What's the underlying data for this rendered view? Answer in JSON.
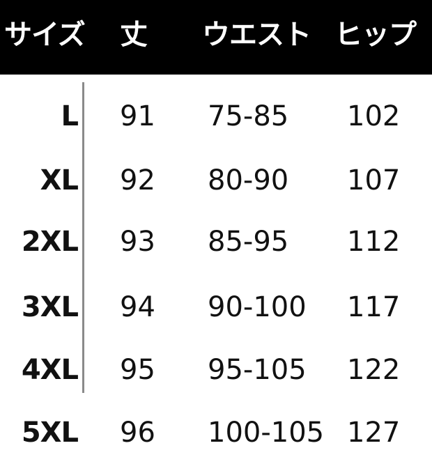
{
  "table": {
    "headers": {
      "size": "サイズ",
      "length": "丈",
      "waist": "ウエスト",
      "hip": "ヒップ"
    },
    "rows": [
      {
        "size": "L",
        "length": "91",
        "waist": "75-85",
        "hip": "102"
      },
      {
        "size": "XL",
        "length": "92",
        "waist": "80-90",
        "hip": "107"
      },
      {
        "size": "2XL",
        "length": "93",
        "waist": "85-95",
        "hip": "112"
      },
      {
        "size": "3XL",
        "length": "94",
        "waist": "90-100",
        "hip": "117"
      },
      {
        "size": "4XL",
        "length": "95",
        "waist": "95-105",
        "hip": "122"
      },
      {
        "size": "5XL",
        "length": "96",
        "waist": "100-105",
        "hip": "127"
      }
    ]
  },
  "colors": {
    "header_background": "#000000",
    "header_text": "#ffffff",
    "body_text": "#111111",
    "divider": "#8a8a8a"
  }
}
